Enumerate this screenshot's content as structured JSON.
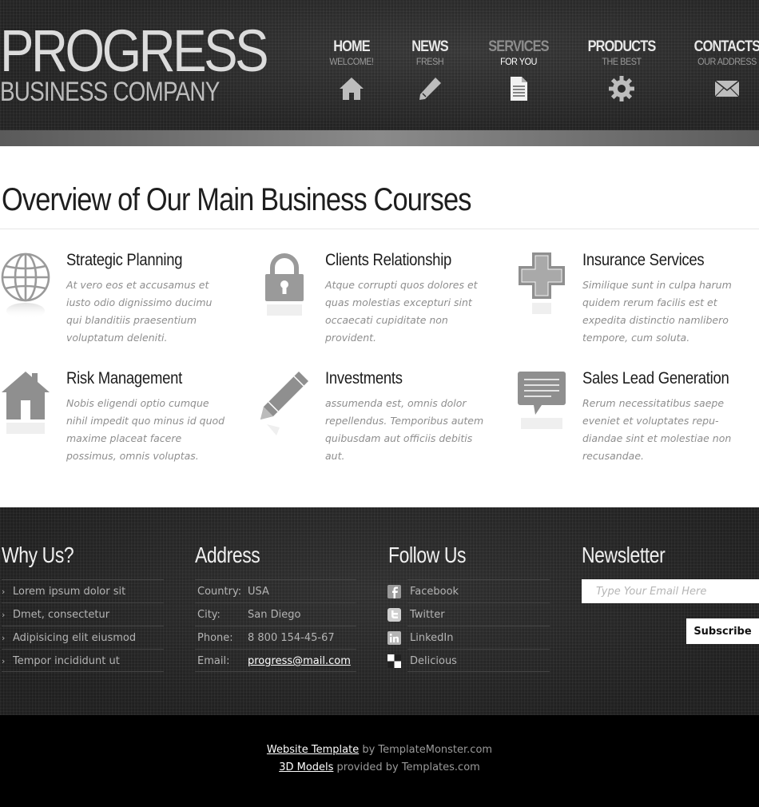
{
  "logo": {
    "main": "PROGRESS",
    "sub": "BUSINESS COMPANY"
  },
  "nav": [
    {
      "title": "HOME",
      "sub": "WELCOME!",
      "icon": "house-icon",
      "active": false
    },
    {
      "title": "NEWS",
      "sub": "FRESH",
      "icon": "pencil-icon",
      "active": false
    },
    {
      "title": "SERVICES",
      "sub": "FOR YOU",
      "icon": "document-icon",
      "active": true
    },
    {
      "title": "PRODUCTS",
      "sub": "THE BEST",
      "icon": "gear-icon",
      "active": false
    },
    {
      "title": "CONTACTS",
      "sub": "OUR ADDRESS",
      "icon": "envelope-icon",
      "active": false
    }
  ],
  "main": {
    "title": "Overview of Our Main Business Courses",
    "courses": [
      {
        "title": "Strategic Planning",
        "text": "At vero eos et accusamus et iusto odio dignissimo ducimu qui blanditiis praesentium voluptatum deleniti.",
        "icon": "globe-icon"
      },
      {
        "title": "Clients Relationship",
        "text": "Atque corrupti quos dolores et quas molestias excepturi sint occaecati cupiditate non provident.",
        "icon": "padlock-icon"
      },
      {
        "title": "Insurance Services",
        "text": "Similique sunt in culpa harum quidem rerum facilis est et expedita distinctio namlibero tempore, cum soluta.",
        "icon": "medical-cross-icon"
      },
      {
        "title": "Risk Management",
        "text": "Nobis eligendi optio cumque nihil impedit quo minus id quod maxime placeat facere possimus, omnis voluptas.",
        "icon": "house-icon"
      },
      {
        "title": "Investments",
        "text": "assumenda est, omnis dolor repellendus. Temporibus autem quibusdam aut officiis debitis aut.",
        "icon": "pencil-icon"
      },
      {
        "title": "Sales Lead Generation",
        "text": "Rerum necessitatibus saepe eveniet et voluptates repu-diandae sint et molestiae non recusandae.",
        "icon": "speech-bubble-icon"
      }
    ]
  },
  "footer": {
    "why": {
      "title": "Why Us?",
      "items": [
        "Lorem ipsum dolor sit",
        "Dmet, consectetur",
        "Adipisicing elit eiusmod",
        "Tempor incididunt ut"
      ]
    },
    "address": {
      "title": "Address",
      "rows": [
        {
          "key": "Country:",
          "value": "USA"
        },
        {
          "key": "City:",
          "value": "San Diego"
        },
        {
          "key": "Phone:",
          "value": "8 800 154-45-67"
        },
        {
          "key": "Email:",
          "value": "progress@mail.com"
        }
      ]
    },
    "follow": {
      "title": "Follow Us",
      "items": [
        {
          "label": "Facebook",
          "icon": "facebook-icon"
        },
        {
          "label": "Twitter",
          "icon": "twitter-icon"
        },
        {
          "label": "LinkedIn",
          "icon": "linkedin-icon"
        },
        {
          "label": "Delicious",
          "icon": "delicious-icon"
        }
      ]
    },
    "newsletter": {
      "title": "Newsletter",
      "placeholder": "Type Your Email Here",
      "button": "Subscribe"
    }
  },
  "bottom": {
    "line1_link": "Website Template",
    "line1_text": " by TemplateMonster.com",
    "line2_link": "3D Models",
    "line2_text": " provided by Templates.com"
  }
}
